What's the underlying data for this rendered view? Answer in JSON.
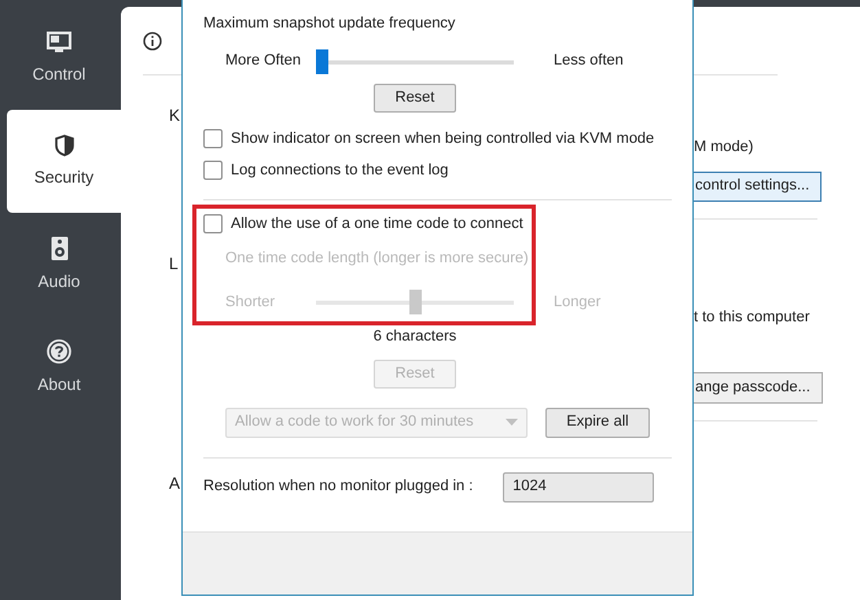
{
  "sidebar": {
    "items": [
      {
        "label": "Control",
        "kind": "monitor",
        "selected": false
      },
      {
        "label": "Security",
        "kind": "shield",
        "selected": true
      },
      {
        "label": "Audio",
        "kind": "speaker",
        "selected": false
      },
      {
        "label": "About",
        "kind": "help",
        "selected": false
      }
    ]
  },
  "background": {
    "left_fragments": [
      "K",
      "L",
      "A"
    ],
    "text_1": "M mode)",
    "button_1": "control settings...",
    "text_2": "t to this computer",
    "button_2": "ange passcode..."
  },
  "dialog": {
    "snapshot": {
      "label": "Maximum snapshot update frequency",
      "min_label": "More Often",
      "max_label": "Less often",
      "level": 0,
      "disabled": false,
      "reset": "Reset"
    },
    "checkboxes": [
      {
        "label": "Show indicator on screen when being controlled via KVM mode",
        "checked": false
      },
      {
        "label": "Log connections to the event log",
        "checked": false
      }
    ],
    "one_time_code": {
      "label": "Allow the use of a one time code to connect",
      "checked": false,
      "length_label": "One time code length (longer is more secure)",
      "min_label": "Shorter",
      "max_label": "Longer",
      "level": 0.5,
      "value": "6 characters",
      "reset": "Reset",
      "disabled": true,
      "duration": "Allow a code to work for 30 minutes",
      "expire_button": "Expire all"
    },
    "resolution": {
      "label": "Resolution when no monitor plugged in :",
      "value": "1024"
    }
  }
}
